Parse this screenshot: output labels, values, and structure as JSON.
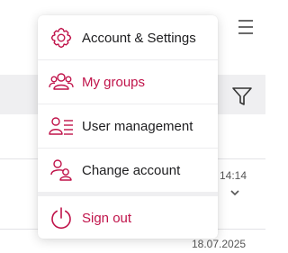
{
  "background": {
    "time_label": "14:14",
    "date_label": "18.07.2025",
    "icons": [
      "hamburger-menu-icon",
      "filter-icon",
      "chevron-down-icon"
    ]
  },
  "menu": {
    "items": [
      {
        "label": "Account & Settings",
        "icon": "gear-icon",
        "color": "#1d1d1f"
      },
      {
        "label": "My groups",
        "icon": "group-icon",
        "color": "#c0134a"
      },
      {
        "label": "User management",
        "icon": "user-list-icon",
        "color": "#1d1d1f"
      },
      {
        "label": "Change account",
        "icon": "switch-user-icon",
        "color": "#1d1d1f"
      },
      {
        "label": "Sign out",
        "icon": "power-icon",
        "color": "#c0134a"
      }
    ]
  },
  "colors": {
    "accent": "#c0134a",
    "text": "#1d1d1f"
  }
}
